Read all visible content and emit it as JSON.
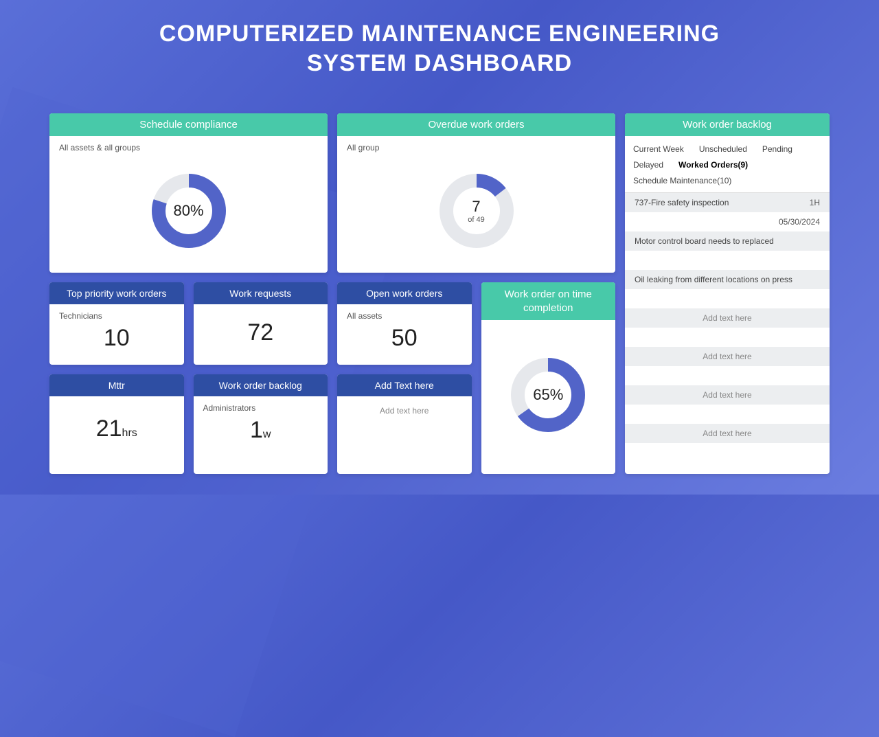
{
  "title_line1": "COMPUTERIZED MAINTENANCE ENGINEERING",
  "title_line2": "SYSTEM DASHBOARD",
  "schedule": {
    "header": "Schedule compliance",
    "sub": "All assets & all groups",
    "pct": "80%",
    "value": 80
  },
  "overdue": {
    "header": "Overdue work orders",
    "sub": "All group",
    "num": "7",
    "of": "of 49",
    "value": 14
  },
  "top_priority": {
    "header": "Top priority work orders",
    "sub": "Technicians",
    "num": "10"
  },
  "work_requests": {
    "header": "Work requests",
    "num": "72"
  },
  "mttr": {
    "header": "Mttr",
    "num": "21",
    "unit": "hrs"
  },
  "wo_backlog_small": {
    "header": "Work order backlog",
    "sub": "Administrators",
    "num": "1",
    "unit": "w"
  },
  "open_wo": {
    "header": "Open work orders",
    "sub": "All assets",
    "num": "50"
  },
  "add_text": {
    "header": "Add Text here",
    "placeholder": "Add text here"
  },
  "ontime": {
    "header": "Work order on time completion",
    "pct": "65%",
    "value": 65
  },
  "backlog": {
    "header": "Work order backlog",
    "tabs": [
      "Current Week",
      "Unscheduled",
      "Pending",
      "Delayed",
      "Worked Orders(9)",
      "Schedule Maintenance(10)"
    ],
    "rows": [
      {
        "t": "737-Fire safety inspection",
        "r": "1H"
      },
      {
        "t": "",
        "r": "05/30/2024"
      },
      {
        "t": "Motor control board needs to replaced",
        "r": ""
      },
      {
        "t": "",
        "r": ""
      },
      {
        "t": "Oil leaking from different locations on press",
        "r": ""
      },
      {
        "t": "",
        "r": ""
      },
      {
        "t": "Add text here",
        "center": true
      },
      {
        "t": "",
        "r": ""
      },
      {
        "t": "Add text here",
        "center": true
      },
      {
        "t": "",
        "r": ""
      },
      {
        "t": "Add text here",
        "center": true
      },
      {
        "t": "",
        "r": ""
      },
      {
        "t": "Add text here",
        "center": true
      }
    ]
  }
}
